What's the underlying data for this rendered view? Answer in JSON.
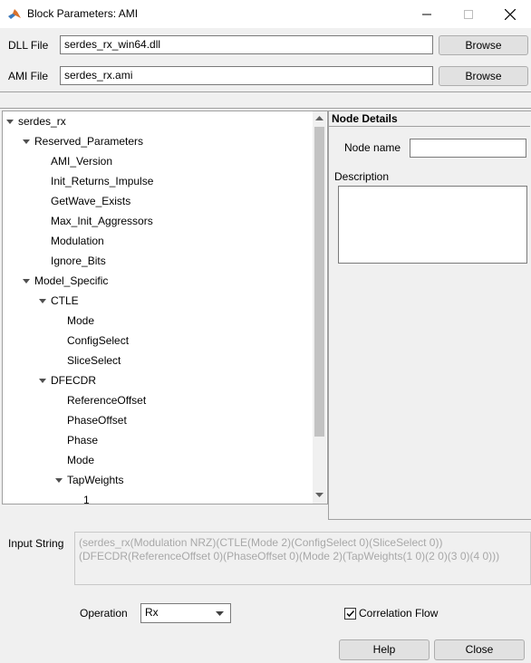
{
  "window": {
    "title": "Block Parameters: AMI"
  },
  "files": {
    "dll": {
      "label": "DLL File",
      "value": "serdes_rx_win64.dll",
      "button": "Browse"
    },
    "ami": {
      "label": "AMI File",
      "value": "serdes_rx.ami",
      "button": "Browse"
    }
  },
  "tree": [
    {
      "label": "serdes_rx",
      "expanded": true
    },
    {
      "label": "Reserved_Parameters",
      "expanded": true
    },
    {
      "label": "AMI_Version"
    },
    {
      "label": "Init_Returns_Impulse"
    },
    {
      "label": "GetWave_Exists"
    },
    {
      "label": "Max_Init_Aggressors"
    },
    {
      "label": "Modulation"
    },
    {
      "label": "Ignore_Bits"
    },
    {
      "label": "Model_Specific",
      "expanded": true
    },
    {
      "label": "CTLE",
      "expanded": true
    },
    {
      "label": "Mode"
    },
    {
      "label": "ConfigSelect"
    },
    {
      "label": "SliceSelect"
    },
    {
      "label": "DFECDR",
      "expanded": true
    },
    {
      "label": "ReferenceOffset"
    },
    {
      "label": "PhaseOffset"
    },
    {
      "label": "Phase"
    },
    {
      "label": "Mode"
    },
    {
      "label": "TapWeights",
      "expanded": true
    },
    {
      "label": "1"
    }
  ],
  "details": {
    "header": "Node Details",
    "node_name_label": "Node name",
    "node_name_value": "",
    "description_label": "Description",
    "description_value": ""
  },
  "input_string": {
    "label": "Input String",
    "line1": "(serdes_rx(Modulation NRZ)(CTLE(Mode 2)(ConfigSelect 0)(SliceSelect 0))",
    "line2": "(DFECDR(ReferenceOffset 0)(PhaseOffset 0)(Mode 2)(TapWeights(1 0)(2 0)(3 0)(4 0)))"
  },
  "operation": {
    "label": "Operation",
    "value": "Rx"
  },
  "correlation_flow": {
    "label": "Correlation Flow",
    "checked": true
  },
  "buttons": {
    "help": "Help",
    "close": "Close"
  }
}
